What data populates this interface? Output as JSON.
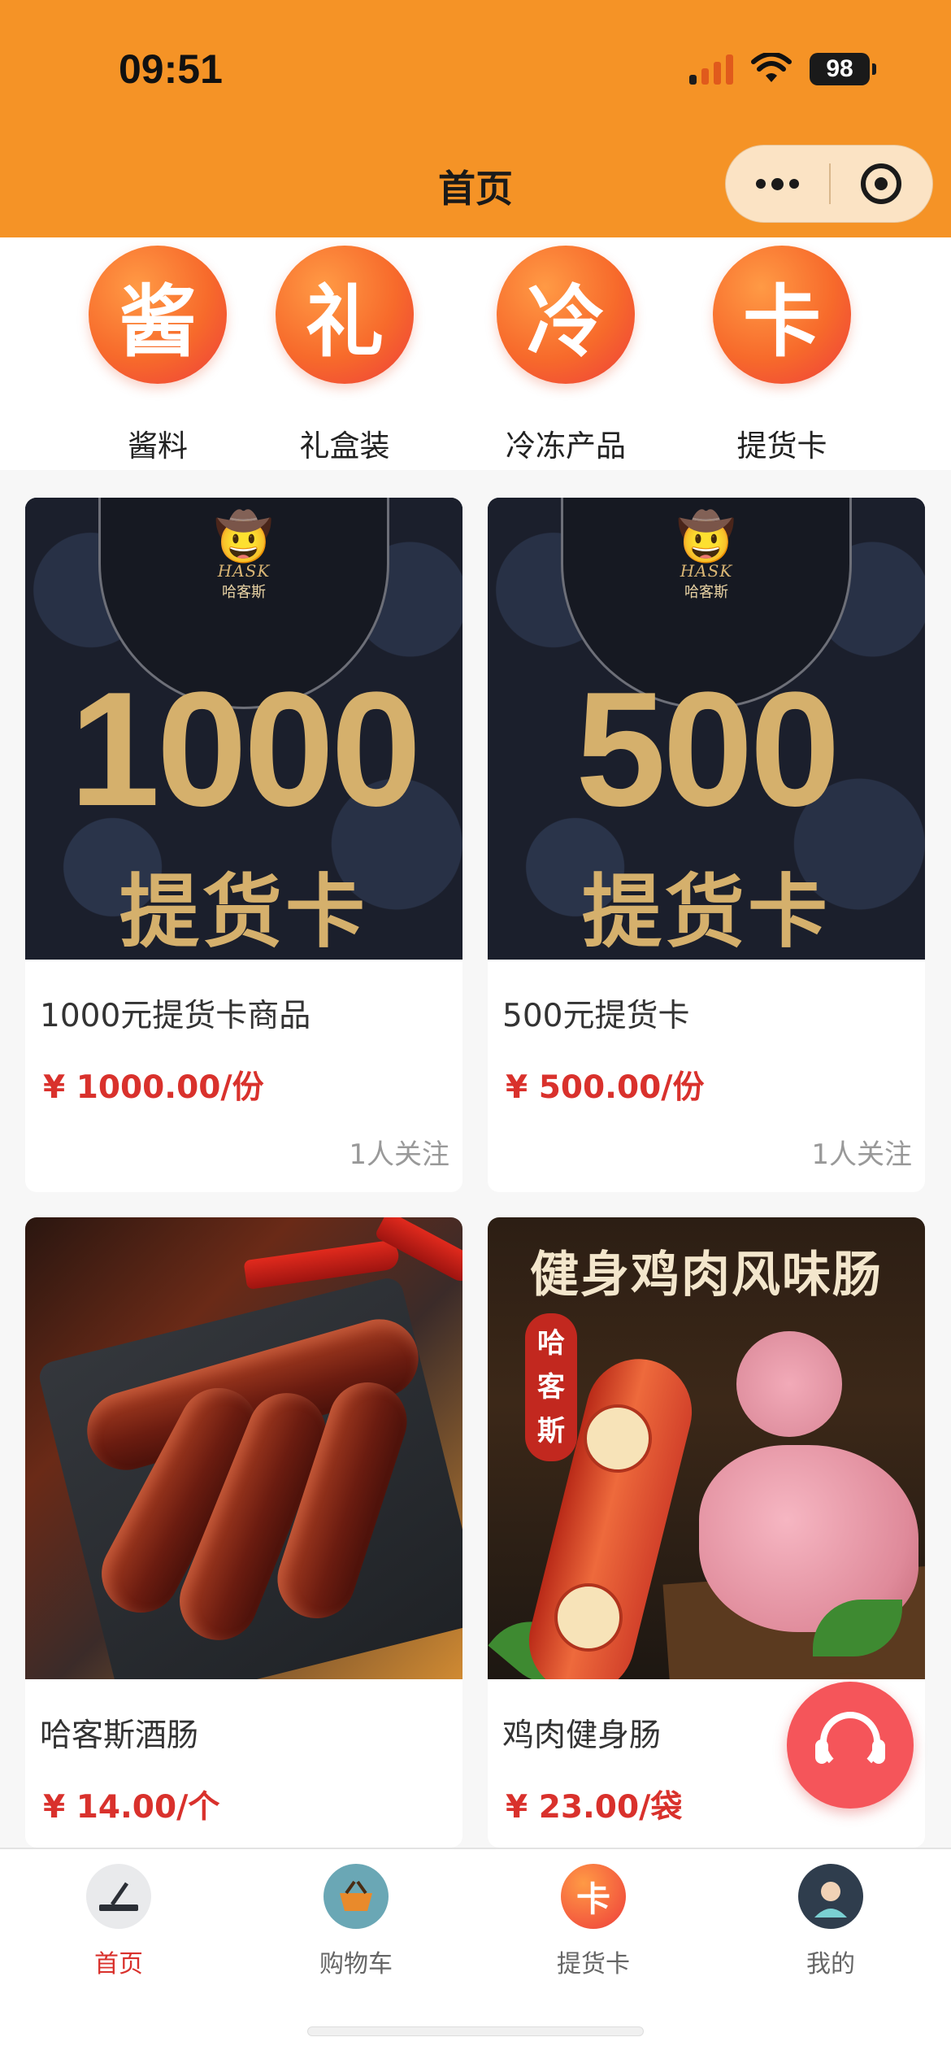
{
  "status_bar": {
    "time": "09:51",
    "battery": "98"
  },
  "nav": {
    "title": "首页"
  },
  "categories": [
    {
      "glyph": "酱",
      "label": "酱料"
    },
    {
      "glyph": "礼",
      "label": "礼盒装"
    },
    {
      "glyph": "冷",
      "label": "冷冻产品"
    },
    {
      "glyph": "卡",
      "label": "提货卡"
    }
  ],
  "products": [
    {
      "name": "1000元提货卡商品",
      "price": "¥ 1000.00/份",
      "followers": "1人关注",
      "image": {
        "amount": "1000",
        "text": "提货卡",
        "brand_en": "HASK",
        "brand_cn": "哈客斯"
      }
    },
    {
      "name": "500元提货卡",
      "price": "¥ 500.00/份",
      "followers": "1人关注",
      "image": {
        "amount": "500",
        "text": "提货卡",
        "brand_en": "HASK",
        "brand_cn": "哈客斯"
      }
    },
    {
      "name": "哈客斯酒肠",
      "price": "¥ 14.00/个"
    },
    {
      "name": "鸡肉健身肠",
      "price": "¥ 23.00/袋",
      "image": {
        "title": "健身鸡肉风味肠",
        "vertical": "哈客斯"
      }
    }
  ],
  "tabbar": [
    {
      "label": "首页",
      "active": true,
      "icon": "home-icon"
    },
    {
      "label": "购物车",
      "active": false,
      "icon": "basket-icon"
    },
    {
      "label": "提货卡",
      "active": false,
      "icon": "card-icon",
      "glyph": "卡"
    },
    {
      "label": "我的",
      "active": false,
      "icon": "avatar-icon"
    }
  ],
  "colors": {
    "header": "#f59326",
    "price": "#d9312c",
    "service": "#f5555a"
  },
  "icons": {
    "service": "headset-icon",
    "more": "more-dots-icon",
    "close": "target-close-icon"
  }
}
